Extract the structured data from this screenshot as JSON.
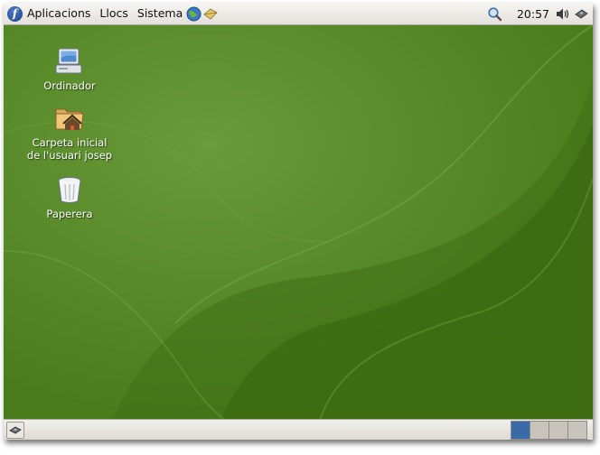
{
  "top_panel": {
    "menus": [
      {
        "label": "Aplicacions"
      },
      {
        "label": "Llocs"
      },
      {
        "label": "Sistema"
      }
    ],
    "clock": "20:57"
  },
  "desktop": {
    "icons": [
      {
        "label": "Ordinador",
        "icon": "computer-icon"
      },
      {
        "label": "Carpeta inicial de l'usuari josep",
        "icon": "home-folder-icon"
      },
      {
        "label": "Paperera",
        "icon": "trash-icon"
      }
    ]
  },
  "bottom_panel": {
    "workspaces": 4,
    "active_workspace": 1
  },
  "colors": {
    "desktop_green": "#3f6f14",
    "active_workspace": "#3b6aa8"
  }
}
